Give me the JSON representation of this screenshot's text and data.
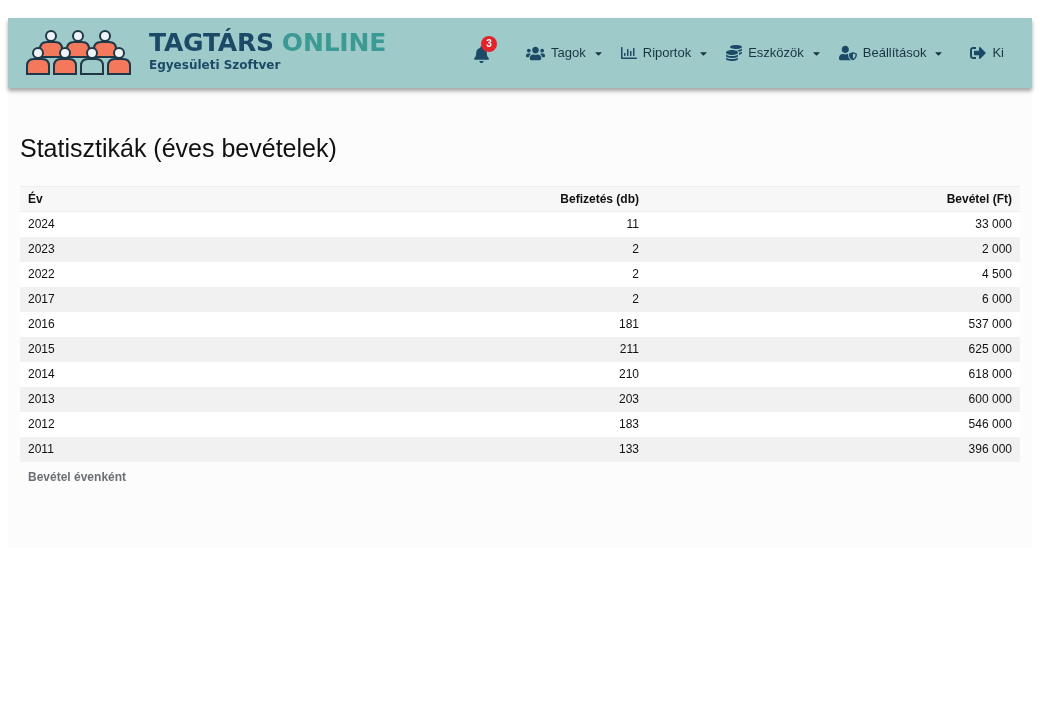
{
  "brand": {
    "name": "TAGTÁRS",
    "name_accent": "ONLINE",
    "tagline": "Egyesületi Szoftver"
  },
  "notifications": {
    "count": "3"
  },
  "menu": [
    {
      "label": "Tagok",
      "kind": "dropdown"
    },
    {
      "label": "Riportok",
      "kind": "dropdown"
    },
    {
      "label": "Eszközök",
      "kind": "dropdown"
    },
    {
      "label": "Beállítások",
      "kind": "dropdown"
    },
    {
      "label": "Ki",
      "kind": "link"
    }
  ],
  "page_title": "Statisztikák (éves bevételek)",
  "table": {
    "columns": [
      {
        "label": "Év",
        "kind": "text"
      },
      {
        "label": "Befizetés (db)",
        "kind": "number"
      },
      {
        "label": "Bevétel (Ft)",
        "kind": "number"
      }
    ],
    "rows": [
      [
        "2024",
        "11",
        "33 000"
      ],
      [
        "2023",
        "2",
        "2 000"
      ],
      [
        "2022",
        "2",
        "4 500"
      ],
      [
        "2017",
        "2",
        "6 000"
      ],
      [
        "2016",
        "181",
        "537 000"
      ],
      [
        "2015",
        "211",
        "625 000"
      ],
      [
        "2014",
        "210",
        "618 000"
      ],
      [
        "2013",
        "203",
        "600 000"
      ],
      [
        "2012",
        "183",
        "546 000"
      ],
      [
        "2011",
        "133",
        "396 000"
      ]
    ],
    "caption": "Bevétel évenként"
  }
}
